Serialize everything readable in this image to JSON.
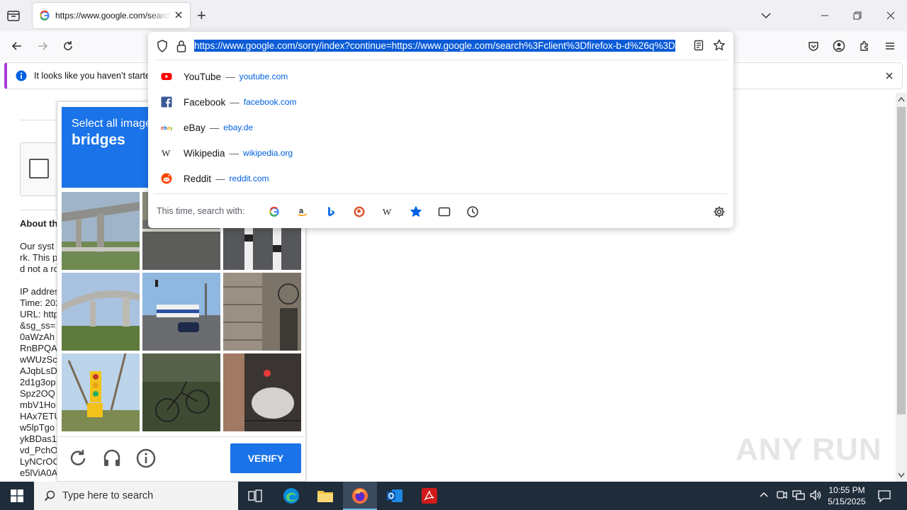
{
  "browser": {
    "tab": {
      "title": "https://www.google.com/search?client=firefox"
    },
    "new_tab_symbol": "+",
    "url": "https://www.google.com/sorry/index?continue=https://www.google.com/search%3Fclient%3Dfirefox-b-d%26q%3D",
    "notification": {
      "text": "It looks like you haven’t started"
    }
  },
  "suggestions": [
    {
      "name": "YouTube",
      "url": "youtube.com",
      "icon": "youtube-icon"
    },
    {
      "name": "Facebook",
      "url": "facebook.com",
      "icon": "facebook-icon"
    },
    {
      "name": "eBay",
      "url": "ebay.de",
      "icon": "ebay-icon"
    },
    {
      "name": "Wikipedia",
      "url": "wikipedia.org",
      "icon": "wikipedia-icon"
    },
    {
      "name": "Reddit",
      "url": "reddit.com",
      "icon": "reddit-icon"
    }
  ],
  "suggestion_separator": "—",
  "search_with": {
    "label": "This time, search with:",
    "engines": [
      "google",
      "amazon",
      "bing",
      "duckduckgo",
      "wikipedia",
      "bookmarks",
      "tabs",
      "history"
    ]
  },
  "page": {
    "heading": "About th",
    "lines": [
      "Our syst",
      "rk. This p",
      "d not a ro",
      "",
      "IP addres",
      "Time: 202",
      "URL: http",
      "&sg_ss=",
      "0aWzAh",
      "RnBPQA",
      "wWUzSc",
      "AJqbLsD",
      "2d1g3op",
      "Spz2OQ",
      "mbV1Ho",
      "HAx7ETU",
      "w5lpTgo",
      "ykBDas1",
      "vd_PchO",
      "LyNCrOO",
      "e5lViA0A"
    ]
  },
  "captcha": {
    "instruction": "Select all images with",
    "target": "bridges",
    "verify_label": "VERIFY"
  },
  "watermark": "ANY RUN",
  "taskbar": {
    "search_placeholder": "Type here to search",
    "time": "10:55 PM",
    "date": "5/15/2025"
  },
  "colors": {
    "accent": "#1a73e8",
    "url_highlight": "#0a5bd7",
    "taskbar": "#1f2c3a"
  }
}
